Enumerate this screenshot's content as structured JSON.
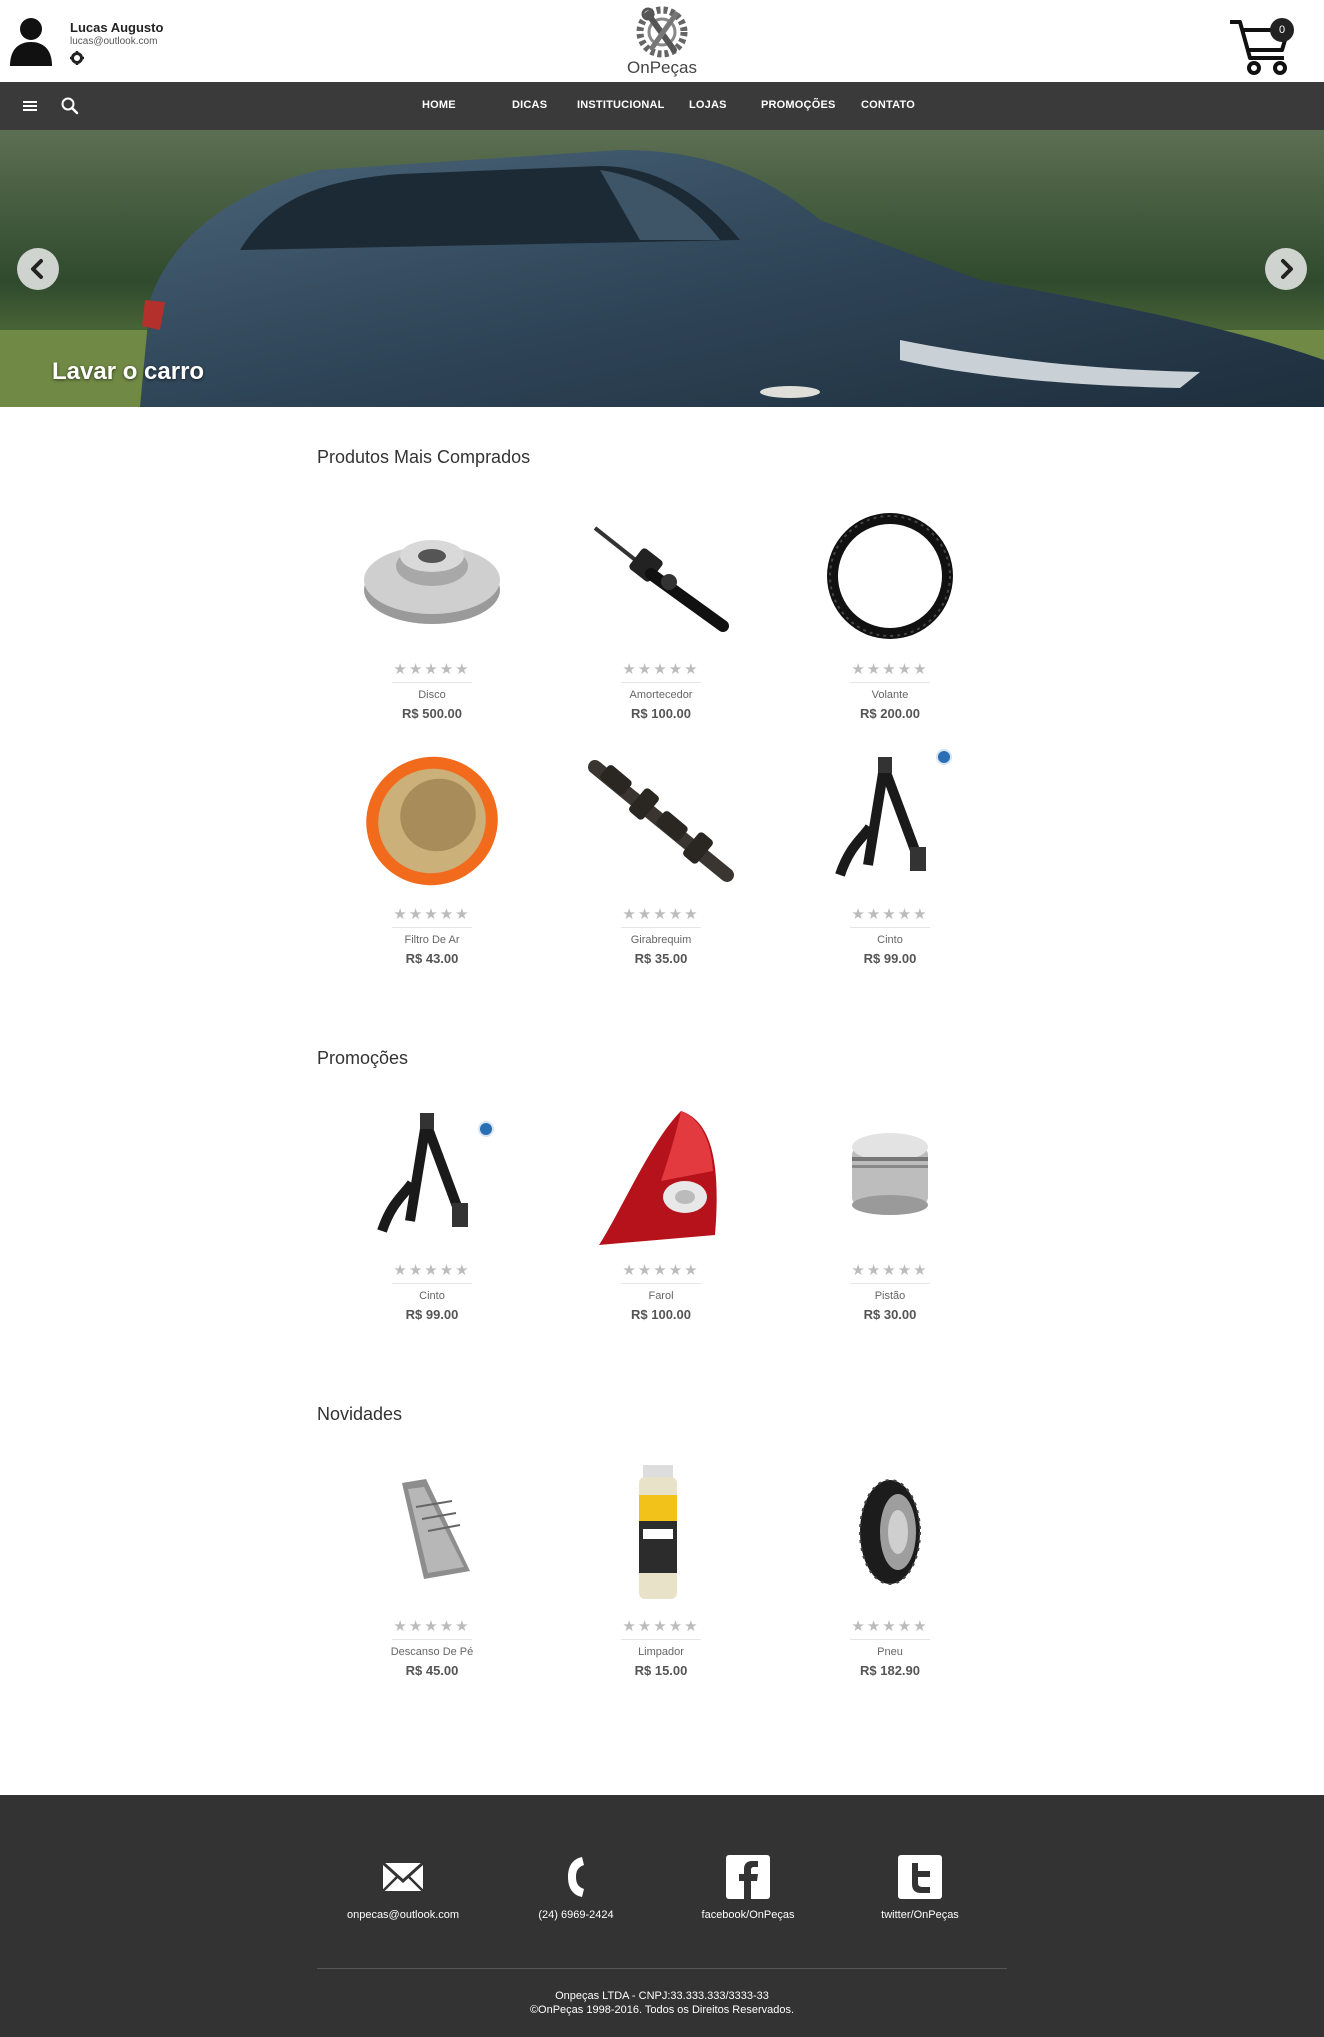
{
  "user": {
    "name": "Lucas Augusto",
    "email": "lucas@outlook.com"
  },
  "brand": {
    "name": "OnPeças"
  },
  "cart": {
    "count": "0"
  },
  "nav": [
    {
      "label": "HOME"
    },
    {
      "label": "DICAS"
    },
    {
      "label": "INSTITUCIONAL"
    },
    {
      "label": "LOJAS"
    },
    {
      "label": "PROMOÇÕES"
    },
    {
      "label": "CONTATO"
    }
  ],
  "hero": {
    "caption": "Lavar o carro"
  },
  "sections": {
    "best_sellers": {
      "title": "Produtos Mais Comprados",
      "products": [
        {
          "name": "Disco",
          "price": "R$ 500.00",
          "rating": 0
        },
        {
          "name": "Amortecedor",
          "price": "R$ 100.00",
          "rating": 0
        },
        {
          "name": "Volante",
          "price": "R$ 200.00",
          "rating": 0
        },
        {
          "name": "Filtro De Ar",
          "price": "R$ 43.00",
          "rating": 0
        },
        {
          "name": "Girabrequim",
          "price": "R$ 35.00",
          "rating": 0
        },
        {
          "name": "Cinto",
          "price": "R$ 99.00",
          "rating": 0
        }
      ]
    },
    "promotions": {
      "title": "Promoções",
      "products": [
        {
          "name": "Cinto",
          "price": "R$ 99.00",
          "rating": 0
        },
        {
          "name": "Farol",
          "price": "R$ 100.00",
          "rating": 0
        },
        {
          "name": "Pistão",
          "price": "R$ 30.00",
          "rating": 0
        }
      ]
    },
    "news": {
      "title": "Novidades",
      "products": [
        {
          "name": "Descanso De Pé",
          "price": "R$ 45.00",
          "rating": 0
        },
        {
          "name": "Limpador",
          "price": "R$ 15.00",
          "rating": 0
        },
        {
          "name": "Pneu",
          "price": "R$ 182.90",
          "rating": 0
        }
      ]
    }
  },
  "stars": "★★★★★",
  "footer": {
    "contacts": [
      {
        "icon": "mail-icon",
        "label": "onpecas@outlook.com"
      },
      {
        "icon": "phone-icon",
        "label": "(24) 6969-2424"
      },
      {
        "icon": "facebook-icon",
        "label": "facebook/OnPeças"
      },
      {
        "icon": "twitter-icon",
        "label": "twitter/OnPeças"
      }
    ],
    "company": "Onpeças LTDA - CNPJ:33.333.333/3333-33",
    "copyright": "©OnPeças 1998-2016. Todos os Direitos Reservados."
  },
  "colors": {
    "navbar": "#3a3a3a",
    "footer": "#333333",
    "badge": "#222222"
  }
}
